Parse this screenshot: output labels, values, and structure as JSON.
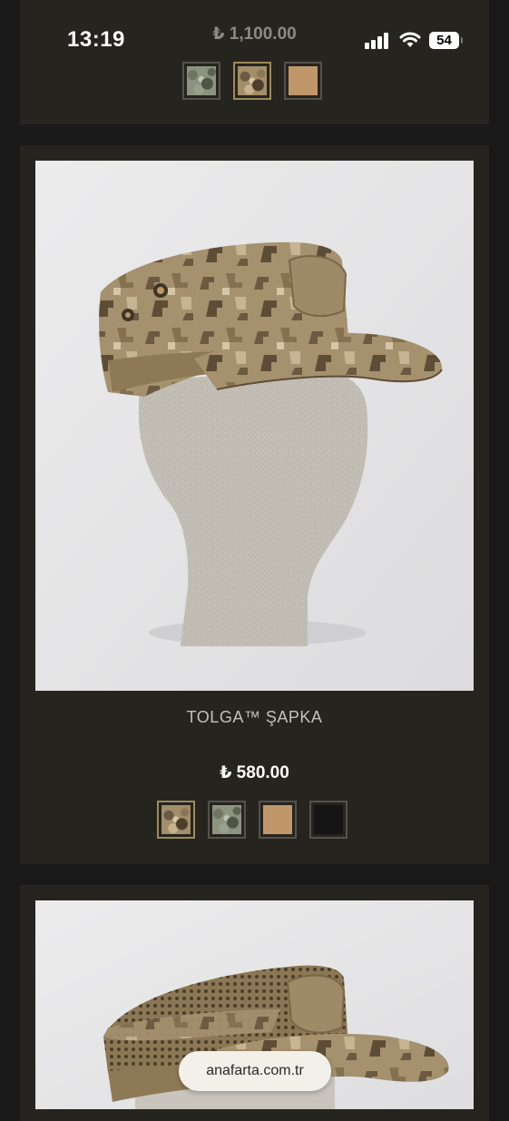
{
  "status_bar": {
    "time": "13:19",
    "battery": "54",
    "icons": [
      "signal-icon",
      "wifi-icon",
      "battery-icon"
    ]
  },
  "previous_product": {
    "price": "₺ 1,100.00",
    "swatches": [
      {
        "name": "camo-green",
        "color": "#8d9381",
        "selected": false
      },
      {
        "name": "camo-desert",
        "color": "#a38e6a",
        "selected": true
      },
      {
        "name": "coyote-solid",
        "color": "#c0976b",
        "selected": false
      }
    ]
  },
  "product": {
    "title": "TOLGA™ ŞAPKA",
    "price": "₺ 580.00",
    "image": "desert camo patrol cap on grey knit mannequin head",
    "swatches": [
      {
        "name": "camo-desert",
        "color": "#a38e6a",
        "selected": true
      },
      {
        "name": "camo-green",
        "color": "#8d9381",
        "selected": false
      },
      {
        "name": "coyote-solid",
        "color": "#c0976b",
        "selected": false
      },
      {
        "name": "black-solid",
        "color": "#151515",
        "selected": false
      }
    ]
  },
  "next_product": {
    "image": "desert camo mesh patrol cap on mannequin head"
  },
  "browser": {
    "url": "anafarta.com.tr"
  },
  "colors": {
    "page_background": "#191919",
    "card_background": "#26241f",
    "selected_border": "#9d8a5b",
    "title_text": "#c4c1b9"
  }
}
